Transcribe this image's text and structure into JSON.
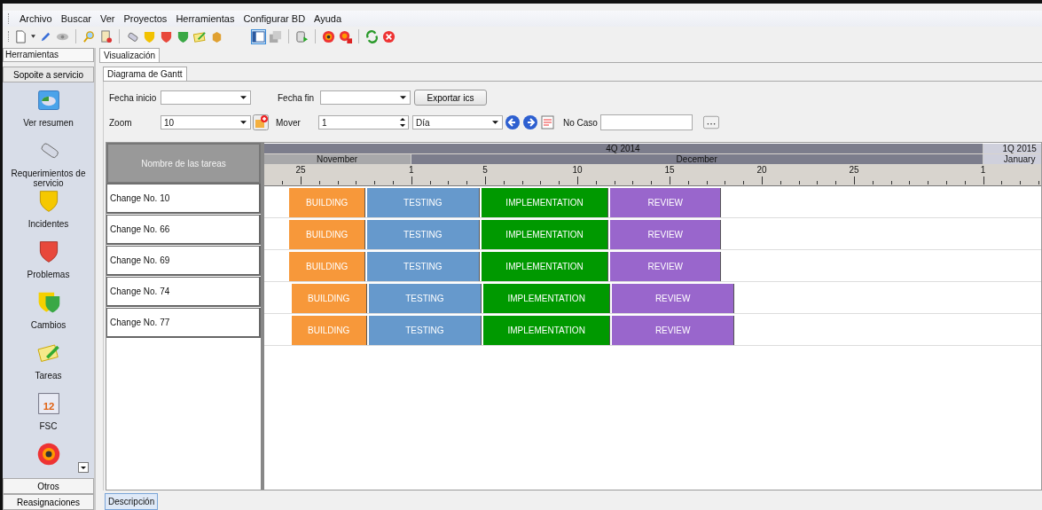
{
  "menu": [
    "Archivo",
    "Buscar",
    "Ver",
    "Proyectos",
    "Herramientas",
    "Configurar BD",
    "Ayuda"
  ],
  "toolbar": [
    {
      "kind": "page"
    },
    {
      "kind": "caret"
    },
    {
      "kind": "pencil"
    },
    {
      "kind": "eye"
    },
    {
      "kind": "sep"
    },
    {
      "kind": "magnifier"
    },
    {
      "kind": "doc"
    },
    {
      "kind": "sep"
    },
    {
      "kind": "phone"
    },
    {
      "kind": "shield",
      "color": "#f2c200"
    },
    {
      "kind": "shield",
      "color": "#e8483b"
    },
    {
      "kind": "shield",
      "color": "#3aa845"
    },
    {
      "kind": "note"
    },
    {
      "kind": "box"
    },
    {
      "kind": "gap"
    },
    {
      "kind": "layout",
      "selected": true
    },
    {
      "kind": "stack",
      "selected": false
    },
    {
      "kind": "sep"
    },
    {
      "kind": "db"
    },
    {
      "kind": "sep"
    },
    {
      "kind": "target"
    },
    {
      "kind": "target-x"
    },
    {
      "kind": "sep"
    },
    {
      "kind": "refresh"
    },
    {
      "kind": "close"
    }
  ],
  "sidebar": {
    "title": "Herramientas",
    "group": "Sopoite a servicio",
    "items": [
      {
        "label": "Ver resumen",
        "kind": "chart"
      },
      {
        "label": "Requerimientos de servicio",
        "kind": "phone"
      },
      {
        "label": "Incidentes",
        "kind": "shield-yellow"
      },
      {
        "label": "Problemas",
        "kind": "shield-red"
      },
      {
        "label": "Cambios",
        "kind": "shield-green"
      },
      {
        "label": "Tareas",
        "kind": "note"
      },
      {
        "label": "FSC",
        "kind": "calendar",
        "badge": "12"
      },
      {
        "kind": "target"
      }
    ],
    "bottom": [
      "Otros",
      "Reasignaciones"
    ]
  },
  "tabs": [
    {
      "label": "Visualización",
      "selected": true
    }
  ],
  "subtabs": [
    {
      "label": "Diagrama de Gantt",
      "selected": true
    }
  ],
  "filters": {
    "start_label": "Fecha inicio",
    "end_label": "Fecha fin",
    "export": "Exportar ics",
    "zoom_label": "Zoom",
    "zoom": "10",
    "move_label": "Mover",
    "move": "1",
    "unit": "Día",
    "case_label": "No Caso"
  },
  "gantt": {
    "header": "Nombre de las tareas",
    "quarters": [
      "4Q 2014",
      "1Q 2015"
    ],
    "months": [
      "November",
      "December",
      "January"
    ],
    "ticks": [
      "25",
      "1",
      "5",
      "10",
      "15",
      "20",
      "25",
      "1"
    ],
    "tasks": [
      {
        "name": "Change No. 10",
        "phases": [
          {
            "label": "BUILDING",
            "kind": "building"
          },
          {
            "label": "TESTING",
            "kind": "testing"
          },
          {
            "label": "IMPLEMENTATION",
            "kind": "implementation"
          },
          {
            "label": "REVIEW",
            "kind": "review"
          }
        ]
      },
      {
        "name": "Change No. 66",
        "phases": [
          {
            "label": "BUILDING",
            "kind": "building"
          },
          {
            "label": "TESTING",
            "kind": "testing"
          },
          {
            "label": "IMPLEMENTATION",
            "kind": "implementation"
          },
          {
            "label": "REVIEW",
            "kind": "review"
          }
        ]
      },
      {
        "name": "Change No. 69",
        "phases": [
          {
            "label": "BUILDING",
            "kind": "building"
          },
          {
            "label": "TESTING",
            "kind": "testing"
          },
          {
            "label": "IMPLEMENTATION",
            "kind": "implementation"
          },
          {
            "label": "REVIEW",
            "kind": "review"
          }
        ]
      },
      {
        "name": "Change No. 74",
        "phases": [
          {
            "label": "BUILDING",
            "kind": "building"
          },
          {
            "label": "TESTING",
            "kind": "testing"
          },
          {
            "label": "IMPLEMENTATION",
            "kind": "implementation"
          },
          {
            "label": "REVIEW",
            "kind": "review"
          }
        ]
      },
      {
        "name": "Change No. 77",
        "phases": [
          {
            "label": "BUILDING",
            "kind": "building"
          },
          {
            "label": "TESTING",
            "kind": "testing"
          },
          {
            "label": "IMPLEMENTATION",
            "kind": "implementation"
          },
          {
            "label": "REVIEW",
            "kind": "review"
          }
        ]
      }
    ]
  },
  "bottom_tabs": [
    {
      "label": "Descripción",
      "selected": true
    }
  ]
}
